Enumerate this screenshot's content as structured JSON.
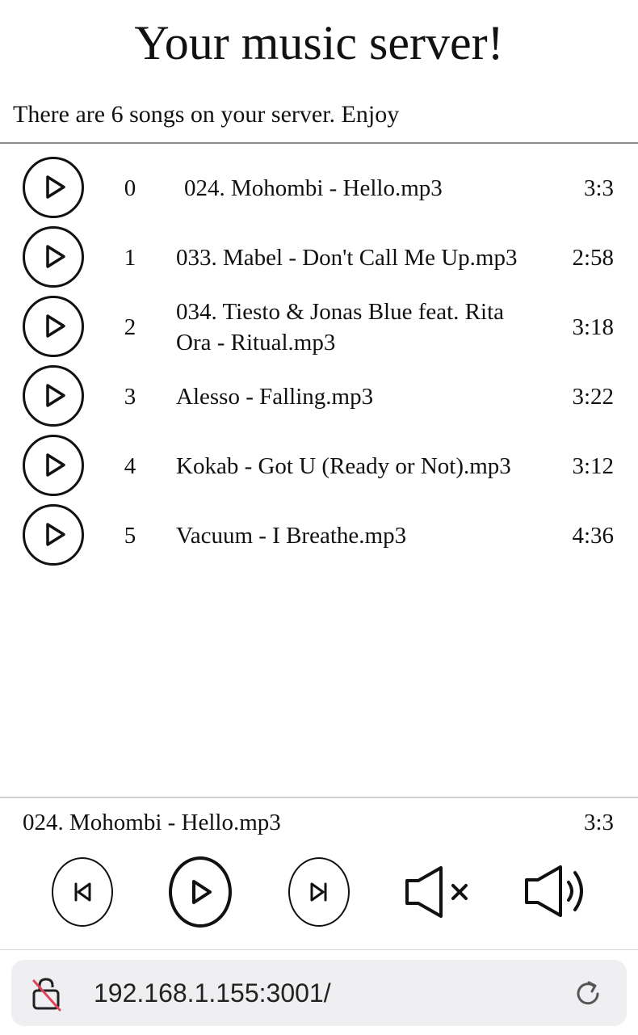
{
  "header": {
    "title": "Your music server!",
    "summary": "There are 6 songs on your server. Enjoy"
  },
  "songs": [
    {
      "index": "0",
      "name": "024. Mohombi - Hello.mp3",
      "duration": "3:3"
    },
    {
      "index": "1",
      "name": "033. Mabel - Don't Call Me Up.mp3",
      "duration": "2:58"
    },
    {
      "index": "2",
      "name": "034. Tiesto & Jonas Blue feat. Rita Ora - Ritual.mp3",
      "duration": "3:18"
    },
    {
      "index": "3",
      "name": "Alesso - Falling.mp3",
      "duration": "3:22"
    },
    {
      "index": "4",
      "name": "Kokab - Got U (Ready or Not).mp3",
      "duration": "3:12"
    },
    {
      "index": "5",
      "name": "Vacuum - I Breathe.mp3",
      "duration": "4:36"
    }
  ],
  "player": {
    "current_title": "024. Mohombi - Hello.mp3",
    "current_duration": "3:3",
    "controls": [
      "previous-icon",
      "play-icon",
      "next-icon",
      "mute-icon",
      "volume-icon"
    ]
  },
  "browser": {
    "url": "192.168.1.155:3001/",
    "icons": [
      "insecure-lock-icon",
      "reload-icon"
    ]
  }
}
